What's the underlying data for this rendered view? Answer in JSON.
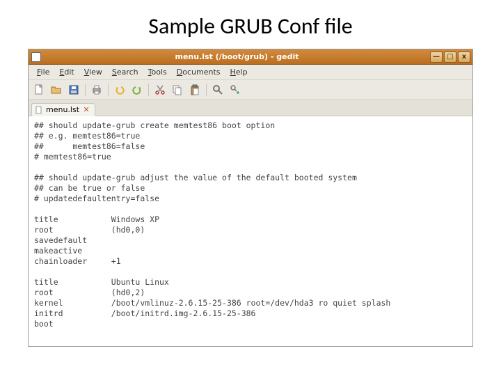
{
  "slide": {
    "title": "Sample GRUB Conf file"
  },
  "window": {
    "title": "menu.lst (/boot/grub) - gedit",
    "minimize": "—",
    "maximize": "□",
    "close": "x"
  },
  "menubar": {
    "file": "File",
    "edit": "Edit",
    "view": "View",
    "search": "Search",
    "tools": "Tools",
    "documents": "Documents",
    "help": "Help"
  },
  "tab": {
    "label": "menu.lst"
  },
  "file_lines": [
    "## should update-grub create memtest86 boot option",
    "## e.g. memtest86=true",
    "##      memtest86=false",
    "# memtest86=true",
    "",
    "## should update-grub adjust the value of the default booted system",
    "## can be true or false",
    "# updatedefaultentry=false",
    "",
    "title           Windows XP",
    "root            (hd0,0)",
    "savedefault",
    "makeactive",
    "chainloader     +1",
    "",
    "title           Ubuntu Linux",
    "root            (hd0,2)",
    "kernel          /boot/vmlinuz-2.6.15-25-386 root=/dev/hda3 ro quiet splash",
    "initrd          /boot/initrd.img-2.6.15-25-386",
    "boot"
  ]
}
